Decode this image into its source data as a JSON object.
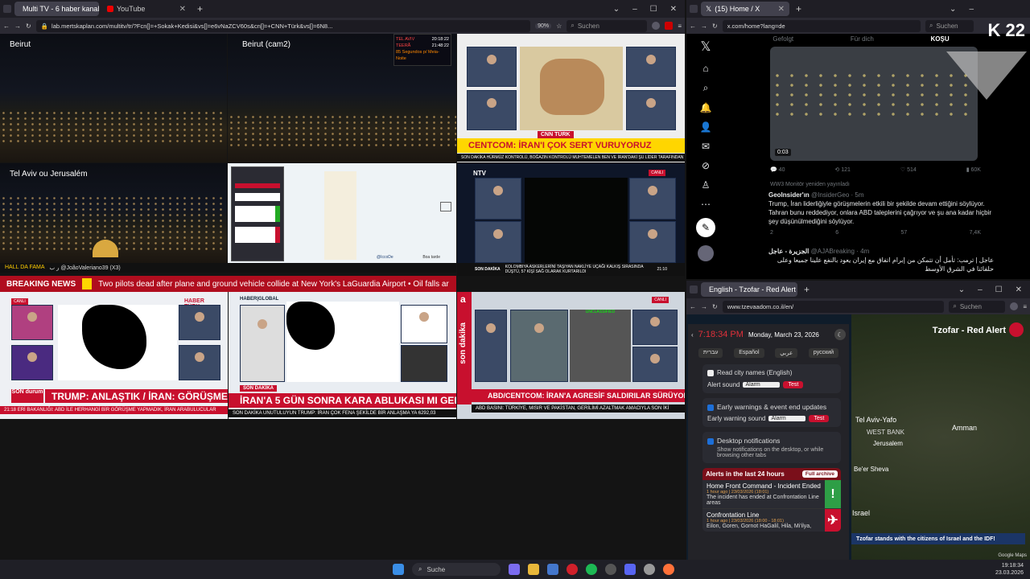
{
  "left_browser": {
    "tabs": [
      {
        "label": "Multi TV - 6 haber kanalını"
      },
      {
        "label": "YouTube"
      }
    ],
    "url": "lab.mertskaplan.com/multitv/tr/?Fcn[]=+Sokak+Kedisi&vs[]=e6vNaZCV60s&cn[]=+CNN+Türk&vs[]=6N8...",
    "zoom": "90%",
    "search_placeholder": "Suchen"
  },
  "cams": {
    "beirut": "Beirut",
    "beirut2": "Beirut (cam2)",
    "telaviv": "Tel Aviv ou Jerusalém"
  },
  "clock_widget": {
    "tel_aviv": "TEL AVIV",
    "tel_aviv_time": "20:18:22",
    "tehran": "TEERÃ",
    "tehran_time": "21:48:22",
    "countdown": "85 Segundos p/ Meia-Noite"
  },
  "cnn": {
    "headline": "CENTCOM: İRAN'I ÇOK SERT VURUYORUZ",
    "logo": "CNN TÜRK",
    "ticker": "SON DAKİKA  HÜRMÜZ KONTROLÜ, BOĞAZIN KONTROLÜ MUHTEMELEN BEN VE İRAN'DAKİ ŞU LİDER TARAFINDAN"
  },
  "ntv": {
    "logo": "NTV",
    "live": "CANLI",
    "ticker_label": "SON DAKİKA",
    "ticker": "KOLOMBIYA ASKERLERİNİ TAŞIYAN NAKLİYE UÇAĞI KALKIŞ SIRASINDA DÜŞTÜ, 57 KİŞİ SAĞ OLARAK KURTARILDI",
    "time": "21:10"
  },
  "map_cell": {
    "credit": "@IccoDe",
    "label": "Boa tarde"
  },
  "hall": {
    "label": "HALL DA FAMA",
    "text": "ر ب @JoãoValeriano39 (X3)"
  },
  "breaking": {
    "label": "BREAKING NEWS",
    "text": "Two pilots dead after plane and ground vehicle collide at New York's LaGuardia Airport  •  Oil falls ar"
  },
  "haberturk": {
    "logo": "HABER TÜRK",
    "live": "CANLI",
    "headline": "TRUMP: ANLAŞTIK / İRAN: GÖRÜŞMEDİK",
    "badge": "SON durum",
    "ticker": "ERİ BAKANLIĞI: ABD İLE HERHANGİ BİR GÖRÜŞME YAPMADIK, İRAN ARABULUCULAR",
    "time": "21:18"
  },
  "haberglobal": {
    "logo": "HABER|GLOBAL",
    "badge": "SON DAKİKA",
    "headline": "İRAN'A 5 GÜN SONRA KARA ABLUKASI MI GELİYOR?",
    "ticker": "SON DAKİKA  UNUTULUYUN  TRUMP: İRAN ÇOK FENA ŞEKİLDE BİR ANLAŞMA YA  6292,03"
  },
  "ahaber": {
    "logo": "a",
    "side": "son dakika",
    "live": "CANLI",
    "headline": "ABD/CENTCOM: İRAN'A AGRESİF SALDIRILAR SÜRÜYOR",
    "ticker": "ABD BASINI: TÜRKİYE, MISIR VE PAKİSTAN, GERİLİMİ AZALTMAK AMACIYLA SON İKİ",
    "label": "UNCLASSIFIED"
  },
  "x_browser": {
    "tab": "(15) Home / X",
    "url": "x.com/home?lang=de",
    "search_placeholder": "Suchen",
    "k22_logo": "K 22",
    "top_tabs": [
      "Gefolgt",
      "Für dich",
      "KOŞU"
    ],
    "video_time": "0:03",
    "post1_stats": [
      "40",
      "121",
      "514",
      "60K"
    ],
    "repost_note": "WW3 Monitör yeniden yayınladı",
    "post2_user": "GeoInsider'ın",
    "post2_handle": "@InsiderGeo · 5m",
    "post2_text": "Trump, İran liderliğiyle görüşmelerin etkili bir şekilde devam ettiğini söylüyor. Tahran bunu reddediyor, onlara ABD taleplerini çağrıyor ve şu ana kadar hiçbir şey düşünülmediğini söylüyor.",
    "post2_stats": [
      "2",
      "6",
      "57",
      "7,4K"
    ],
    "post3_user": "الجزيرة - عاجل",
    "post3_handle": "@AJABreaking · 4m",
    "post3_text": "عاجل | ترمب: تأمل أن تتمكن من إبرام اتفاق مع إيران يعود بالنفع علينا جميعا وعلى حلفائنا في الشرق الأوسط"
  },
  "tzeva": {
    "tab": "English - Tzofar - Red Alert",
    "url": "www.tzevaadom.co.il/en/",
    "search_placeholder": "Suchen",
    "time": "7:18:34 PM",
    "date": "Monday, March 23, 2026",
    "langs": [
      "עברית",
      "Español",
      "عربي",
      "русский"
    ],
    "read_city": "Read city names (English)",
    "alert_sound_label": "Alert sound",
    "alert_sound_value": "Alarm",
    "test": "Test",
    "early_title": "Early warnings & event end updates",
    "early_sound_label": "Early warning sound",
    "desktop_title": "Desktop notifications",
    "desktop_desc": "Show notifications on the desktop, or while browsing other tabs",
    "alerts_title": "Alerts in the last 24 hours",
    "full_archive": "Full archive",
    "alert1_title": "Home Front Command - Incident Ended",
    "alert1_time": "1 hour ago | 23/03/2026 (18:01)",
    "alert1_body": "The incident has ended at Confrontation Line areas",
    "alert2_title": "Confrontation Line",
    "alert2_time": "1 hour ago | 23/03/2026 (18:00 - 18:01)",
    "alert2_body": "Eilon, Goren, Gornot HaGalil, Hila, Mi'ilya,",
    "map_title": "Tzofar - Red Alert",
    "map_places": [
      "Tel Aviv-Yafo",
      "WEST BANK",
      "Amman",
      "Jerusalem",
      "Be'er Sheva",
      "Israel"
    ],
    "banner": "Tzofar stands with the citizens of Israel and the IDF!",
    "map_credit": "Google Maps"
  },
  "taskbar": {
    "search": "Suche",
    "time": "19:18:34",
    "date": "23.03.2026"
  },
  "colors": {
    "red": "#c8102e",
    "x_blue": "#1d9bf0",
    "dark": "#1c1b22"
  }
}
